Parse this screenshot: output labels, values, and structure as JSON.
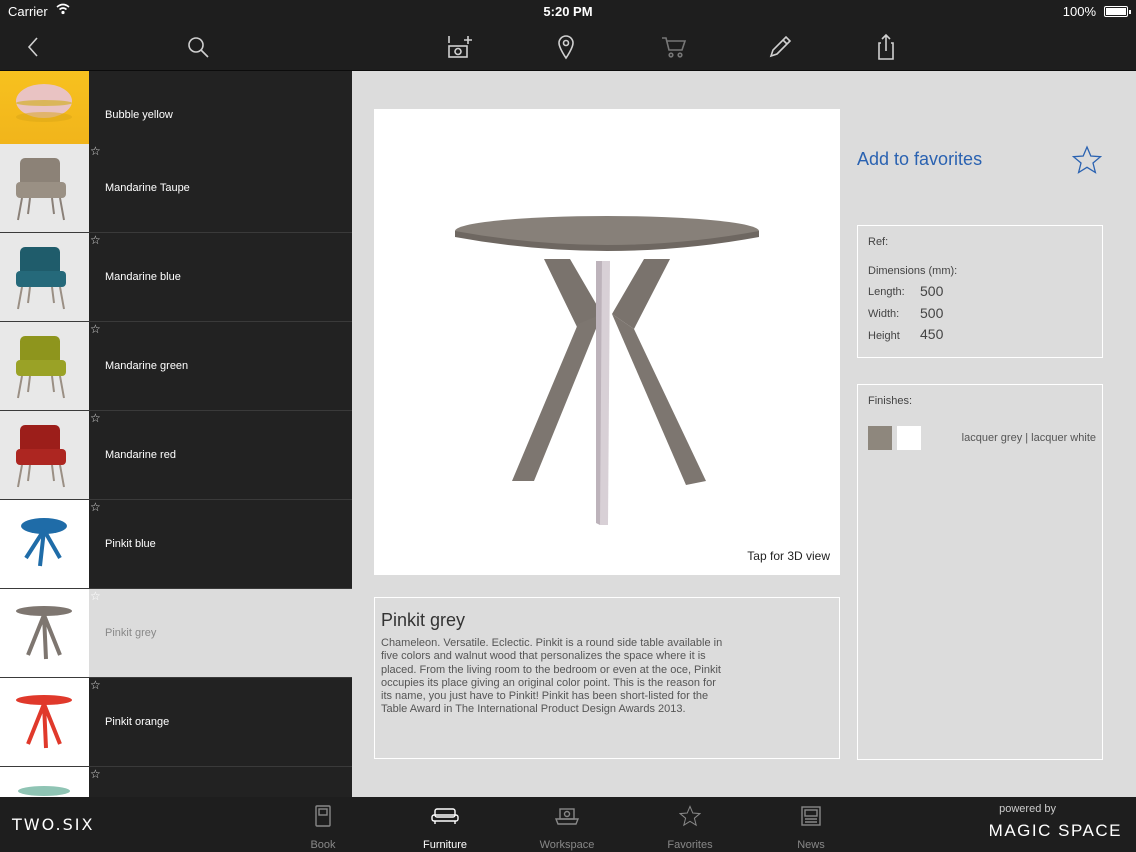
{
  "status": {
    "carrier": "Carrier",
    "time": "5:20 PM",
    "battery": "100%"
  },
  "toolbar": {
    "icons": [
      "back-icon",
      "search-icon",
      "add-photo-icon",
      "location-pin-icon",
      "cart-icon",
      "pencil-icon",
      "share-icon"
    ]
  },
  "sidebar": {
    "items": [
      {
        "label": "Bubble yellow",
        "thumb": "yellow",
        "selected": false
      },
      {
        "label": "Mandarine Taupe",
        "thumb": "taupe-chair",
        "selected": false
      },
      {
        "label": "Mandarine blue",
        "thumb": "blue-chair",
        "selected": false
      },
      {
        "label": "Mandarine green",
        "thumb": "green-chair",
        "selected": false
      },
      {
        "label": "Mandarine red",
        "thumb": "red-chair",
        "selected": false
      },
      {
        "label": "Pinkit blue",
        "thumb": "blue-table",
        "selected": false
      },
      {
        "label": "Pinkit grey",
        "thumb": "grey-table",
        "selected": true
      },
      {
        "label": "Pinkit orange",
        "thumb": "orange-table",
        "selected": false
      },
      {
        "label": "",
        "thumb": "mint-table",
        "selected": false
      }
    ]
  },
  "product": {
    "tap_3d": "Tap for 3D view",
    "name": "Pinkit grey",
    "description": "Chameleon. Versatile. Eclectic. Pinkit is a round side table available in five colors and walnut wood that personalizes the space where it is placed. From the living room to the bedroom or even at the oce, Pinkit occupies its place giving an original color point. This is the reason for its name, you just have to Pinkit! Pinkit has been short-listed for the Table Award in The International Product Design Awards 2013.",
    "favorites_label": "Add to favorites",
    "ref_label": "Ref:",
    "dimensions_label": "Dimensions (mm):",
    "length_label": "Length:",
    "length_value": "500",
    "width_label": "Width:",
    "width_value": "500",
    "height_label": "Height",
    "height_value": "450",
    "finishes_label": "Finishes:",
    "finish_colors": [
      "#8e877d",
      "#ffffff"
    ],
    "finishes_text": "lacquer grey | lacquer white"
  },
  "tabbar": {
    "brand_left": "TWO.SIX",
    "tabs": [
      {
        "label": "Book",
        "icon": "book-icon"
      },
      {
        "label": "Furniture",
        "icon": "sofa-icon",
        "active": true
      },
      {
        "label": "Workspace",
        "icon": "workspace-icon"
      },
      {
        "label": "Favorites",
        "icon": "star-icon"
      },
      {
        "label": "News",
        "icon": "news-icon"
      }
    ],
    "powered_by": "powered by",
    "brand_right": "MAGIC SPACE"
  },
  "colors": {
    "accent": "#2a62b1",
    "dark": "#1e1e1e",
    "panel": "#dcdcdc"
  }
}
